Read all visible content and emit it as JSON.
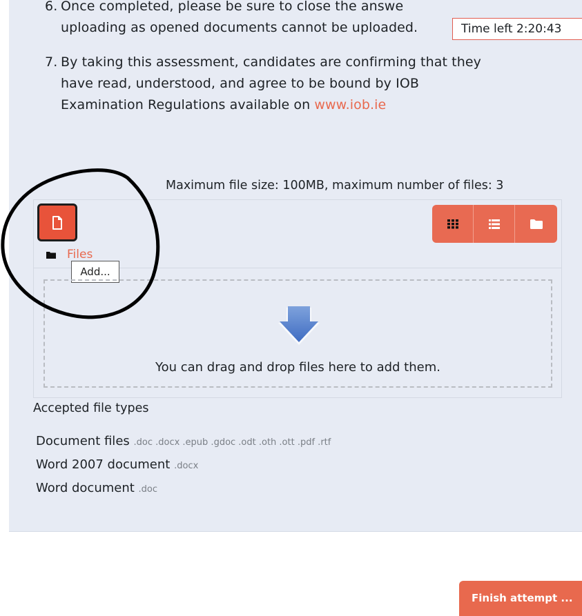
{
  "instructions": [
    {
      "num": "6.",
      "line1": "Once completed, please be sure to close the answe",
      "line2": "uploading as opened documents cannot be uploaded."
    },
    {
      "num": "7.",
      "line1": "By taking this assessment, candidates are confirming that they",
      "line2": "have read, understood, and agree to be bound by IOB",
      "line3_prefix": "Examination Regulations available on ",
      "link": "www.iob.ie"
    }
  ],
  "timer": {
    "label": "Time left 2:20:43"
  },
  "filemanager": {
    "max_info": "Maximum file size: 100MB, maximum number of files: 3",
    "crumb": "Files",
    "tooltip": "Add...",
    "drop_text": "You can drag and drop files here to add them."
  },
  "accepted": {
    "heading": "Accepted file types",
    "types": [
      {
        "name": "Document files",
        "ext": ".doc .docx .epub .gdoc .odt .oth .ott .pdf .rtf"
      },
      {
        "name": "Word 2007 document",
        "ext": ".docx"
      },
      {
        "name": "Word document",
        "ext": ".doc"
      }
    ]
  },
  "finish": {
    "label": "Finish attempt ..."
  },
  "colors": {
    "accent": "#e8694e",
    "panel": "#e7ebf4",
    "annotation": "#000000"
  }
}
